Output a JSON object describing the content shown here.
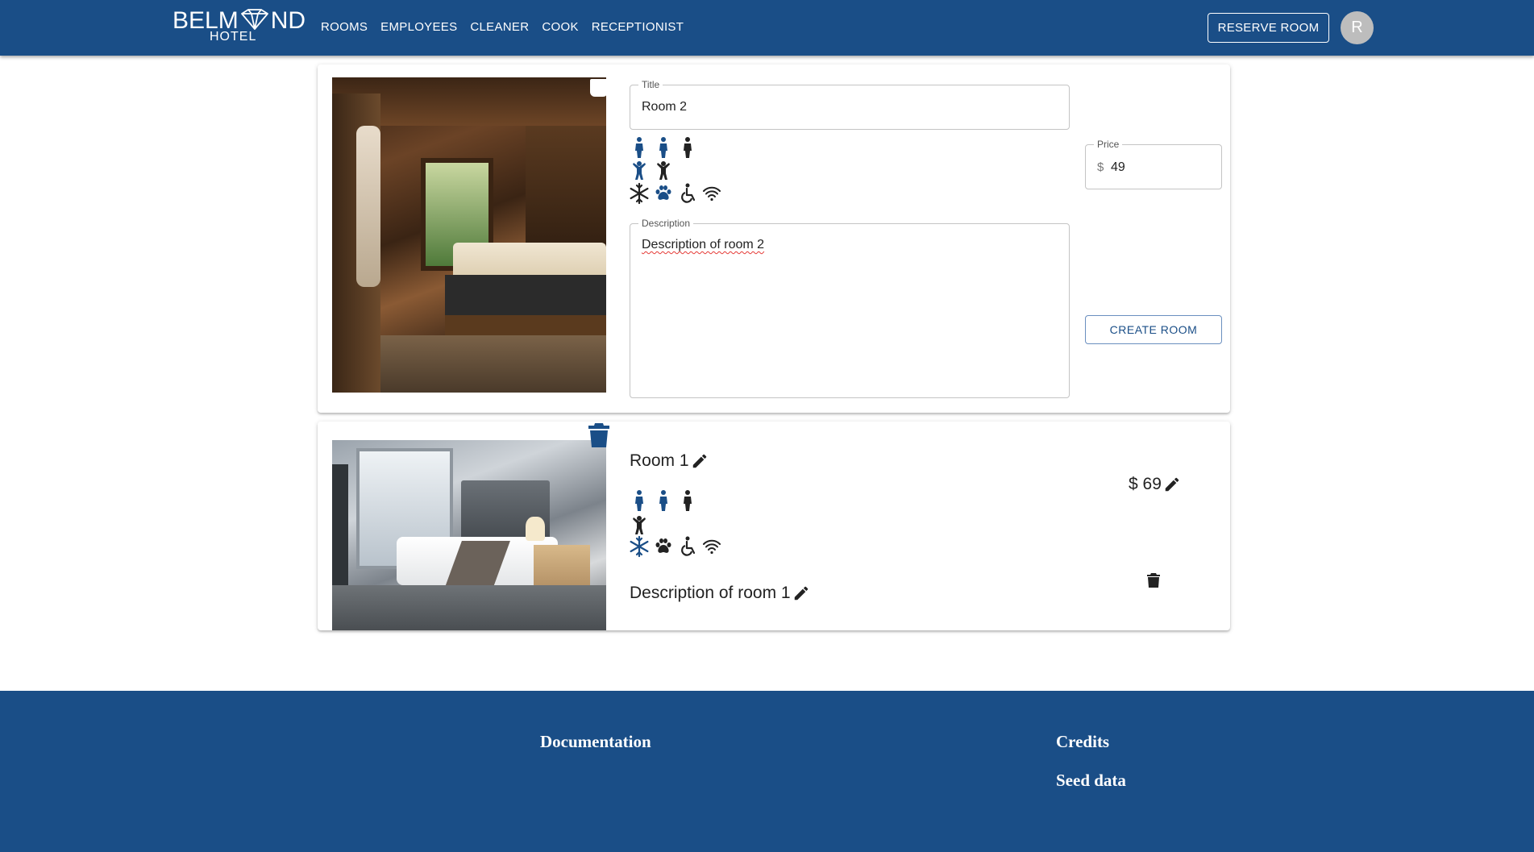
{
  "brand": {
    "name": "BELMOND",
    "subtitle": "HOTEL",
    "logo_icon": "diamond-icon"
  },
  "nav": {
    "links": [
      "ROOMS",
      "EMPLOYEES",
      "CLEANER",
      "COOK",
      "RECEPTIONIST"
    ],
    "reserve_label": "RESERVE ROOM",
    "avatar_initial": "R"
  },
  "new_room": {
    "title_legend": "Title",
    "title_value": "Room 2",
    "price_legend": "Price",
    "price_prefix": "$",
    "price_value": "49",
    "description_legend": "Description",
    "description_value": "Description of room 2",
    "create_label": "CREATE ROOM",
    "guest_icons": [
      "person-blue",
      "person-blue",
      "person-dark",
      "child-blue",
      "child-dark"
    ],
    "amenity_icons": [
      "snowflake-dark",
      "paw-blue",
      "wheelchair-dark",
      "wifi-dark"
    ]
  },
  "rooms": [
    {
      "title": "Room 1",
      "price": "$ 69",
      "description": "Description of room 1",
      "guest_icons": [
        "person-blue",
        "person-blue",
        "person-dark",
        "child-dark"
      ],
      "amenity_icons": [
        "snowflake-blue",
        "paw-dark",
        "wheelchair-dark",
        "wifi-dark"
      ]
    }
  ],
  "footer": {
    "documentation": "Documentation",
    "credits": "Credits",
    "seed": "Seed data"
  },
  "colors": {
    "primary": "#1a4e87",
    "text": "#222222",
    "avatar": "#bdbdbd"
  }
}
